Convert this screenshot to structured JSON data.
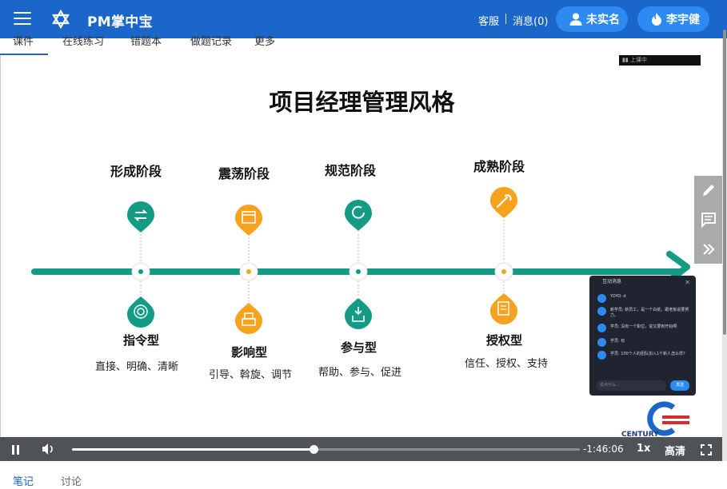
{
  "header": {
    "title": "PM掌中宝",
    "service_label": "客服",
    "messages_label": "消息(0)",
    "real_name_label": "未实名",
    "user_name": "李宇健",
    "brand_color": "#1a66c9",
    "pill_color": "#2d8af0"
  },
  "tabs": [
    {
      "label": "课件"
    },
    {
      "label": "在线练习"
    },
    {
      "label": "错题本"
    },
    {
      "label": "做题记录"
    },
    {
      "label": "更多"
    }
  ],
  "slide": {
    "title": "项目经理管理风格",
    "stages": [
      "形成阶段",
      "震荡阶段",
      "规范阶段",
      "成熟阶段"
    ],
    "styles": [
      {
        "name": "指令型",
        "desc": "直接、明确、清晰"
      },
      {
        "name": "影响型",
        "desc": "引导、斡旋、调节"
      },
      {
        "name": "参与型",
        "desc": "帮助、参与、促进"
      },
      {
        "name": "授权型",
        "desc": "信任、授权、支持"
      }
    ],
    "stage_colors": [
      "#149b86",
      "#f5a21e",
      "#149b86",
      "#f5a21e"
    ],
    "timeline_color": "#149b86",
    "mini_window_label": "上课中",
    "watermark": "CENTURY"
  },
  "chat": {
    "title": "互动消息",
    "messages": [
      {
        "name": "YOYO",
        "text": "d"
      },
      {
        "name": "新学员",
        "text": "新员工，是一个白纸，跟老板说要努力。"
      },
      {
        "name": "学员",
        "text": "没有一个职位，说又要到开始啊"
      },
      {
        "name": "学员",
        "text": "有"
      },
      {
        "name": "学员",
        "text": "100个人的团队加入1个新人怎么样？"
      }
    ],
    "input_placeholder": "说点什么...",
    "send_label": "发送"
  },
  "player": {
    "progress": 0.475,
    "time_remaining": "-1:46:06",
    "rate": "1x",
    "quality": "高清"
  },
  "bottom_tabs": [
    {
      "label": "笔记",
      "active": true
    },
    {
      "label": "讨论",
      "active": false
    }
  ]
}
